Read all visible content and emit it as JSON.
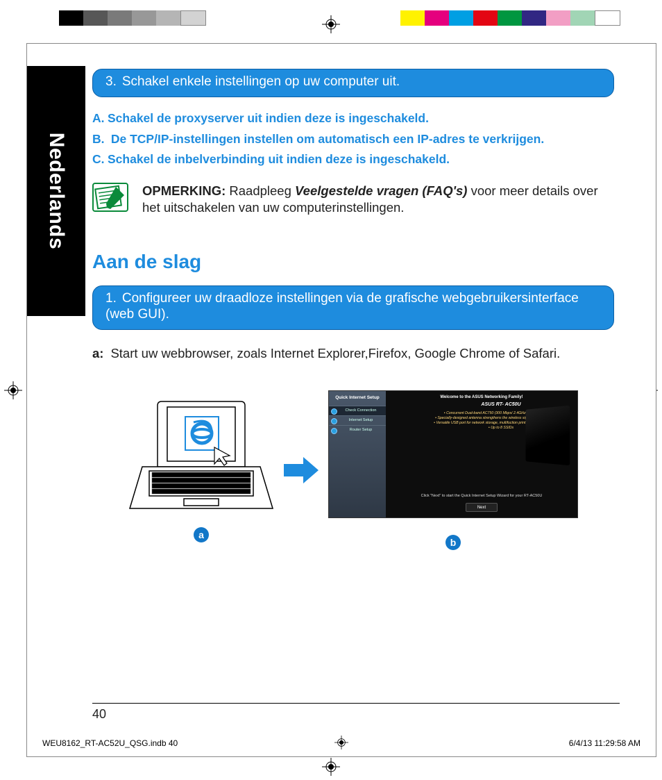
{
  "lang_tab": "Nederlands",
  "step3": {
    "num": "3.",
    "text": "Schakel enkele instellingen op uw computer uit."
  },
  "sublist": [
    {
      "lbl": "A.",
      "text": "Schakel de proxyserver uit indien deze is ingeschakeld."
    },
    {
      "lbl": "B.",
      "text": " De TCP/IP-instellingen instellen om automatisch een IP-adres te verkrijgen."
    },
    {
      "lbl": "C.",
      "text": "Schakel de inbelverbinding uit indien deze is ingeschakeld."
    }
  ],
  "note": {
    "caption": "OPMERKING:",
    "pre": " Raadpleeg ",
    "bold": "Veelgestelde vragen (FAQ's)",
    "post": " voor meer details over het uitschakelen van uw computerinstellingen."
  },
  "section_title": "Aan de slag",
  "step1": {
    "num": "1.",
    "text": "Configureer uw draadloze instellingen via de grafische webgebruikersinterface (web GUI)."
  },
  "para_a": {
    "lbl": "a:",
    "text": "Start uw webbrowser, zoals Internet Explorer,Firefox, Google Chrome of Safari."
  },
  "fig_labels": {
    "a": "a",
    "b": "b"
  },
  "ui": {
    "setup_hdr": "Quick Internet Setup",
    "items": [
      "Check Connection",
      "Internet Setup",
      "Router Setup"
    ],
    "welcome": "Welcome to the ASUS Networking Family!",
    "model": "ASUS RT- AC50U",
    "bullets": [
      "Concurrent Dual-band AC750 (300 Mbps/ 2.4GHz + 433 Mbps/ 5GHz)",
      "Specially-designed antenna strengthens the wireless signal up to 150% coverage",
      "Versatile USB port for network storage, multifuction printer server or 3G/4G backup",
      "Up to 8 SSIDs"
    ],
    "prompt": "Click \"Next\" to start the Quick Internet Setup Wizard for your RT-AC50U",
    "next": "Next"
  },
  "page_num": "40",
  "footer_left": "WEU8162_RT-AC52U_QSG.indb   40",
  "footer_right": "6/4/13   11:29:58 AM",
  "colorbar": [
    "#000",
    "#666",
    "#888",
    "#aaa",
    "#ccc",
    "#eee",
    "transparent",
    "transparent",
    "transparent",
    "transparent",
    "transparent",
    "transparent",
    "transparent",
    "transparent",
    "#fff700",
    "#e5007e",
    "#00a0e0",
    "#e30613",
    "#009640",
    "#312783",
    "#f29ec4",
    "#80c8a0",
    "#fff"
  ]
}
